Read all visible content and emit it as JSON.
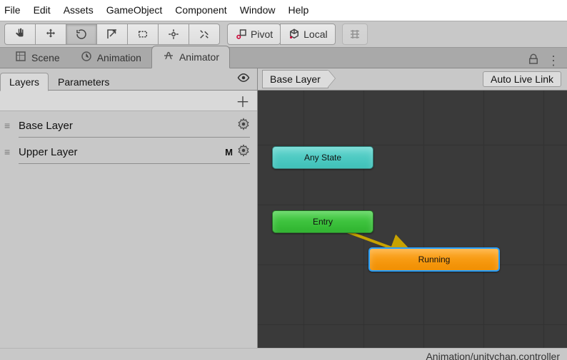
{
  "menu": [
    "File",
    "Edit",
    "Assets",
    "GameObject",
    "Component",
    "Window",
    "Help"
  ],
  "toolbar": {
    "pivot": "Pivot",
    "local": "Local"
  },
  "tabs": {
    "scene": "Scene",
    "animation": "Animation",
    "animator": "Animator"
  },
  "subtabs": {
    "layers": "Layers",
    "parameters": "Parameters"
  },
  "breadcrumb": {
    "root": "Base Layer"
  },
  "livelink": "Auto Live Link",
  "layers": [
    {
      "name": "Base Layer",
      "mask": ""
    },
    {
      "name": "Upper Layer",
      "mask": "M"
    }
  ],
  "graph_nodes": {
    "any_state": "Any State",
    "entry": "Entry",
    "running": "Running"
  },
  "status": "Animation/unitychan.controller"
}
